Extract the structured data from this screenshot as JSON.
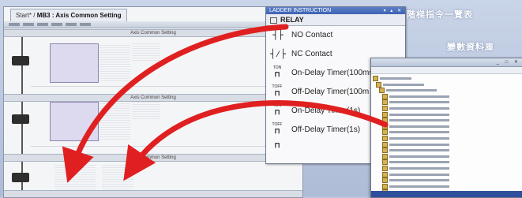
{
  "editor": {
    "tab_label": "Start*",
    "tab_title": "MB3 : Axis Common Setting",
    "rung_header_1": "Axis Common Setting",
    "rung_header_2": "Axis Common Setting",
    "rung_header_3": "Axis Common Setting"
  },
  "instruction_list": {
    "caption": "階梯指令一覽表",
    "window_title": "LADDER INSTRUCTION",
    "group_label": "RELAY",
    "items": [
      {
        "symbol": "-||-",
        "label": "NO Contact"
      },
      {
        "symbol": "-|/|-",
        "label": "NC Contact"
      },
      {
        "symbol": "TON",
        "label": "On-Delay Timer(100ms"
      },
      {
        "symbol": "TOFF",
        "label": "Off-Delay Timer(100m"
      },
      {
        "symbol": "TON",
        "label": "On-Delay Timer(1s)"
      },
      {
        "symbol": "TOFF",
        "label": "Off-Delay Timer(1s)"
      }
    ]
  },
  "variable_db": {
    "caption": "變數資料庫"
  },
  "colors": {
    "arrow": "#e02020",
    "caption_text": "#ffffff",
    "panel_title": "#3d63b3",
    "function_block": "#ddd9ee"
  }
}
